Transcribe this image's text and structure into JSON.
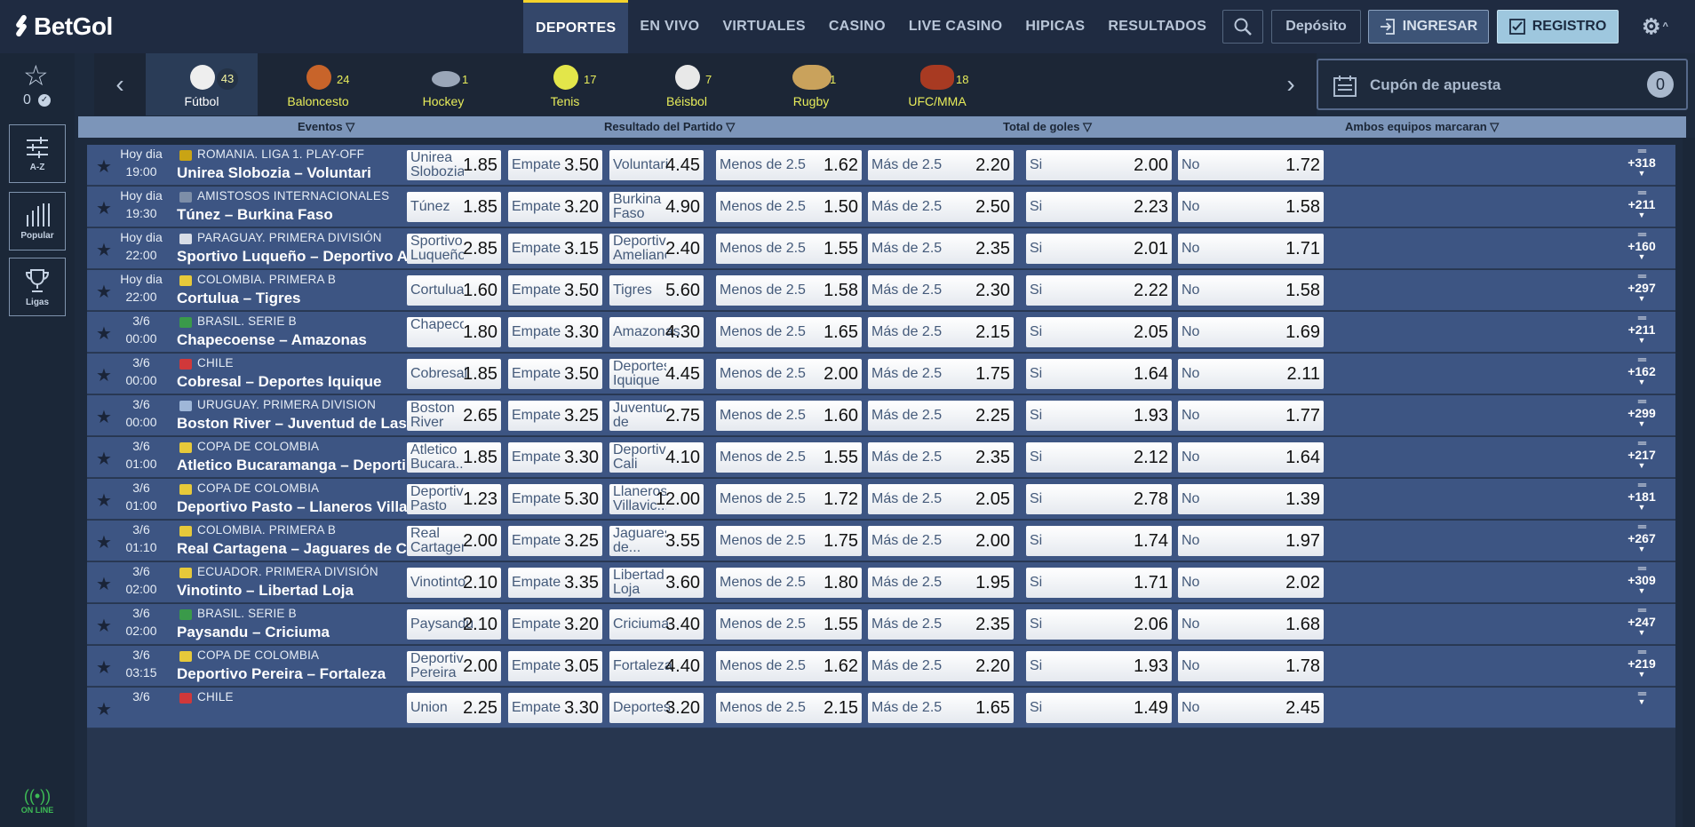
{
  "brand": {
    "name": "BetGol"
  },
  "nav": [
    "DEPORTES",
    "EN VIVO",
    "VIRTUALES",
    "CASINO",
    "LIVE CASINO",
    "HIPICAS",
    "RESULTADOS"
  ],
  "topbar": {
    "deposit": "Depósito",
    "login": "INGRESAR",
    "register": "REGISTRO"
  },
  "left_rail": {
    "fav_count": "0",
    "az": "A-Z",
    "popular": "Popular",
    "leagues": "Ligas",
    "online": "ON LINE"
  },
  "sports": [
    {
      "name": "Fútbol",
      "count": "43",
      "icon": "soccer-ball-icon",
      "color": "#eeeeee"
    },
    {
      "name": "Baloncesto",
      "count": "24",
      "icon": "basketball-icon",
      "color": "#c8642a"
    },
    {
      "name": "Hockey",
      "count": "1",
      "icon": "hockey-puck-icon",
      "color": "#9aa6b8"
    },
    {
      "name": "Tenis",
      "count": "17",
      "icon": "tennis-ball-icon",
      "color": "#e3e64a"
    },
    {
      "name": "Béisbol",
      "count": "7",
      "icon": "baseball-icon",
      "color": "#e8e8e8"
    },
    {
      "name": "Rugby",
      "count": "1",
      "icon": "rugby-ball-icon",
      "color": "#c9a25c"
    },
    {
      "name": "UFC/MMA",
      "count": "18",
      "icon": "boxing-gloves-icon",
      "color": "#a83a22"
    }
  ],
  "coupon": {
    "label": "Cupón de apuesta",
    "count": "0"
  },
  "columns": {
    "events": "Eventos",
    "result": "Resultado del Partido",
    "goals": "Total de goles",
    "btts": "Ambos equipos marcaran"
  },
  "events": [
    {
      "date": "Hoy dia",
      "time": "19:00",
      "flag": "#c9a414",
      "league": "ROMANIA. LIGA 1. PLAY-OFF",
      "match": "Unirea Slobozia – Voluntari",
      "home": "Unirea Slobozia",
      "h": "1.85",
      "draw": "Empate",
      "d": "3.50",
      "away": "Voluntari",
      "a": "4.45",
      "under": "Menos de 2.5",
      "u": "1.62",
      "over": "Más de 2.5",
      "o": "2.20",
      "yes": "Si",
      "y": "2.00",
      "no": "No",
      "n": "1.72",
      "more": "+318"
    },
    {
      "date": "Hoy dia",
      "time": "19:30",
      "flag": "#7d8ea8",
      "league": "AMISTOSOS INTERNACIONALES",
      "match": "Túnez – Burkina Faso",
      "home": "Túnez",
      "h": "1.85",
      "draw": "Empate",
      "d": "3.20",
      "away": "Burkina Faso",
      "a": "4.90",
      "under": "Menos de 2.5",
      "u": "1.50",
      "over": "Más de 2.5",
      "o": "2.50",
      "yes": "Si",
      "y": "2.23",
      "no": "No",
      "n": "1.58",
      "more": "+211"
    },
    {
      "date": "Hoy dia",
      "time": "22:00",
      "flag": "#d8dde6",
      "league": "PARAGUAY. PRIMERA DIVISIÓN",
      "match": "Sportivo Luqueño – Deportivo Ameliano",
      "home": "Sportivo Luqueño",
      "h": "2.85",
      "draw": "Empate",
      "d": "3.15",
      "away": "Deportivo Ameliano",
      "a": "2.40",
      "under": "Menos de 2.5",
      "u": "1.55",
      "over": "Más de 2.5",
      "o": "2.35",
      "yes": "Si",
      "y": "2.01",
      "no": "No",
      "n": "1.71",
      "more": "+160"
    },
    {
      "date": "Hoy dia",
      "time": "22:00",
      "flag": "#e6c93a",
      "league": "COLOMBIA. PRIMERA B",
      "match": "Cortulua – Tigres",
      "home": "Cortulua",
      "h": "1.60",
      "draw": "Empate",
      "d": "3.50",
      "away": "Tigres",
      "a": "5.60",
      "under": "Menos de 2.5",
      "u": "1.58",
      "over": "Más de 2.5",
      "o": "2.30",
      "yes": "Si",
      "y": "2.22",
      "no": "No",
      "n": "1.58",
      "more": "+297"
    },
    {
      "date": "3/6",
      "time": "00:00",
      "flag": "#3a9a4a",
      "league": "BRASIL. SERIE B",
      "match": "Chapecoense – Amazonas",
      "home": "Chapecoense",
      "h": "1.80",
      "draw": "Empate",
      "d": "3.30",
      "away": "Amazonas",
      "a": "4.30",
      "under": "Menos de 2.5",
      "u": "1.65",
      "over": "Más de 2.5",
      "o": "2.15",
      "yes": "Si",
      "y": "2.05",
      "no": "No",
      "n": "1.69",
      "more": "+211"
    },
    {
      "date": "3/6",
      "time": "00:00",
      "flag": "#d0383a",
      "league": "CHILE",
      "match": "Cobresal – Deportes Iquique",
      "home": "Cobresal",
      "h": "1.85",
      "draw": "Empate",
      "d": "3.50",
      "away": "Deportes Iquique",
      "a": "4.45",
      "under": "Menos de 2.5",
      "u": "2.00",
      "over": "Más de 2.5",
      "o": "1.75",
      "yes": "Si",
      "y": "1.64",
      "no": "No",
      "n": "2.11",
      "more": "+162"
    },
    {
      "date": "3/6",
      "time": "00:00",
      "flag": "#9fb7d8",
      "league": "URUGUAY. PRIMERA DIVISION",
      "match": "Boston River – Juventud de Las Piedras",
      "home": "Boston River",
      "h": "2.65",
      "draw": "Empate",
      "d": "3.25",
      "away": "Juventud de Las...",
      "a": "2.75",
      "under": "Menos de 2.5",
      "u": "1.60",
      "over": "Más de 2.5",
      "o": "2.25",
      "yes": "Si",
      "y": "1.93",
      "no": "No",
      "n": "1.77",
      "more": "+299"
    },
    {
      "date": "3/6",
      "time": "01:00",
      "flag": "#e6c93a",
      "league": "COPA DE COLOMBIA",
      "match": "Atletico Bucaramanga – Deportivo Cali",
      "home": "Atletico Bucara...",
      "h": "1.85",
      "draw": "Empate",
      "d": "3.30",
      "away": "Deportivo Cali",
      "a": "4.10",
      "under": "Menos de 2.5",
      "u": "1.55",
      "over": "Más de 2.5",
      "o": "2.35",
      "yes": "Si",
      "y": "2.12",
      "no": "No",
      "n": "1.64",
      "more": "+217"
    },
    {
      "date": "3/6",
      "time": "01:00",
      "flag": "#e6c93a",
      "league": "COPA DE COLOMBIA",
      "match": "Deportivo Pasto – Llaneros Villavicencio",
      "home": "Deportivo Pasto",
      "h": "1.23",
      "draw": "Empate",
      "d": "5.30",
      "away": "Llaneros Villavic...",
      "a": "12.00",
      "under": "Menos de 2.5",
      "u": "1.72",
      "over": "Más de 2.5",
      "o": "2.05",
      "yes": "Si",
      "y": "2.78",
      "no": "No",
      "n": "1.39",
      "more": "+181"
    },
    {
      "date": "3/6",
      "time": "01:10",
      "flag": "#e6c93a",
      "league": "COLOMBIA. PRIMERA B",
      "match": "Real Cartagena – Jaguares de Córdoba",
      "home": "Real Cartagena",
      "h": "2.00",
      "draw": "Empate",
      "d": "3.25",
      "away": "Jaguares de...",
      "a": "3.55",
      "under": "Menos de 2.5",
      "u": "1.75",
      "over": "Más de 2.5",
      "o": "2.00",
      "yes": "Si",
      "y": "1.74",
      "no": "No",
      "n": "1.97",
      "more": "+267"
    },
    {
      "date": "3/6",
      "time": "02:00",
      "flag": "#e6c93a",
      "league": "ECUADOR. PRIMERA DIVISIÓN",
      "match": "Vinotinto – Libertad Loja",
      "home": "Vinotinto",
      "h": "2.10",
      "draw": "Empate",
      "d": "3.35",
      "away": "Libertad Loja",
      "a": "3.60",
      "under": "Menos de 2.5",
      "u": "1.80",
      "over": "Más de 2.5",
      "o": "1.95",
      "yes": "Si",
      "y": "1.71",
      "no": "No",
      "n": "2.02",
      "more": "+309"
    },
    {
      "date": "3/6",
      "time": "02:00",
      "flag": "#3a9a4a",
      "league": "BRASIL. SERIE B",
      "match": "Paysandu – Criciuma",
      "home": "Paysandu",
      "h": "2.10",
      "draw": "Empate",
      "d": "3.20",
      "away": "Criciuma",
      "a": "3.40",
      "under": "Menos de 2.5",
      "u": "1.55",
      "over": "Más de 2.5",
      "o": "2.35",
      "yes": "Si",
      "y": "2.06",
      "no": "No",
      "n": "1.68",
      "more": "+247"
    },
    {
      "date": "3/6",
      "time": "03:15",
      "flag": "#e6c93a",
      "league": "COPA DE COLOMBIA",
      "match": "Deportivo Pereira – Fortaleza",
      "home": "Deportivo Pereira",
      "h": "2.00",
      "draw": "Empate",
      "d": "3.05",
      "away": "Fortaleza",
      "a": "4.40",
      "under": "Menos de 2.5",
      "u": "1.62",
      "over": "Más de 2.5",
      "o": "2.20",
      "yes": "Si",
      "y": "1.93",
      "no": "No",
      "n": "1.78",
      "more": "+219"
    },
    {
      "date": "3/6",
      "time": "",
      "flag": "#d0383a",
      "league": "CHILE",
      "match": "",
      "home": "Union",
      "h": "2.25",
      "draw": "Empate",
      "d": "3.30",
      "away": "Deportes",
      "a": "3.20",
      "under": "Menos de 2.5",
      "u": "2.15",
      "over": "Más de 2.5",
      "o": "1.65",
      "yes": "Si",
      "y": "1.49",
      "no": "No",
      "n": "2.45",
      "more": ""
    }
  ]
}
